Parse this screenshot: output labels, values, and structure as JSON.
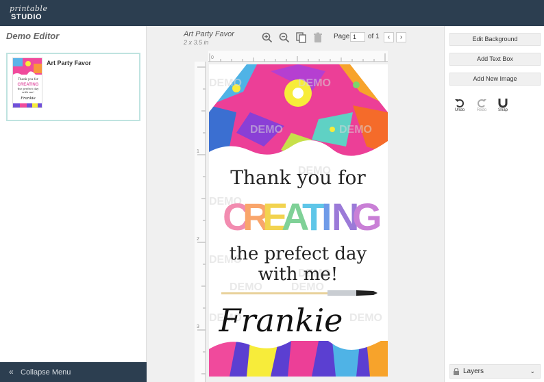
{
  "logo": {
    "line1": "printable",
    "line2": "STUDIO"
  },
  "left_panel": {
    "title": "Demo Editor",
    "template_name": "Art Party Favor",
    "collapse_label": "Collapse Menu"
  },
  "document": {
    "title": "Art Party Favor",
    "size": "2 x 3.5 in"
  },
  "toolbar": {
    "zoom_in_icon": "zoom-in-icon",
    "zoom_out_icon": "zoom-out-icon",
    "duplicate_icon": "copy-icon",
    "delete_icon": "trash-icon"
  },
  "pagination": {
    "label": "Page",
    "current": "1",
    "of_label": "of 1",
    "prev": "‹",
    "next": "›"
  },
  "ruler": {
    "top_zero": "0",
    "left_marks": [
      "1",
      "2",
      "3"
    ]
  },
  "tag": {
    "line1": "Thank you for",
    "line2_letters": [
      "C",
      "R",
      "E",
      "A",
      "T",
      "I",
      "N",
      "G"
    ],
    "line2_colors": [
      "#f28cb0",
      "#f9a56b",
      "#f2d34f",
      "#7fd197",
      "#5fc6e8",
      "#6f9be8",
      "#9b7ad8",
      "#c97fd6"
    ],
    "line3": "the prefect day",
    "line4": "with me!",
    "name": "Frankie",
    "watermark": "DEMO"
  },
  "thumbnail": {
    "line1": "Thank you for",
    "line2": "CREATING",
    "line3": "the prefect day",
    "line4": "with me!",
    "name": "Frankie"
  },
  "right_panel": {
    "edit_background": "Edit Background",
    "add_text_box": "Add Text Box",
    "add_new_image": "Add New Image",
    "undo": "Undo",
    "redo": "Redo",
    "snap": "Snap",
    "layers": "Layers"
  },
  "colors": {
    "topbar": "#2c3e50",
    "accent_border": "#bfe3e0",
    "panel_button": "#f0f0f0"
  }
}
